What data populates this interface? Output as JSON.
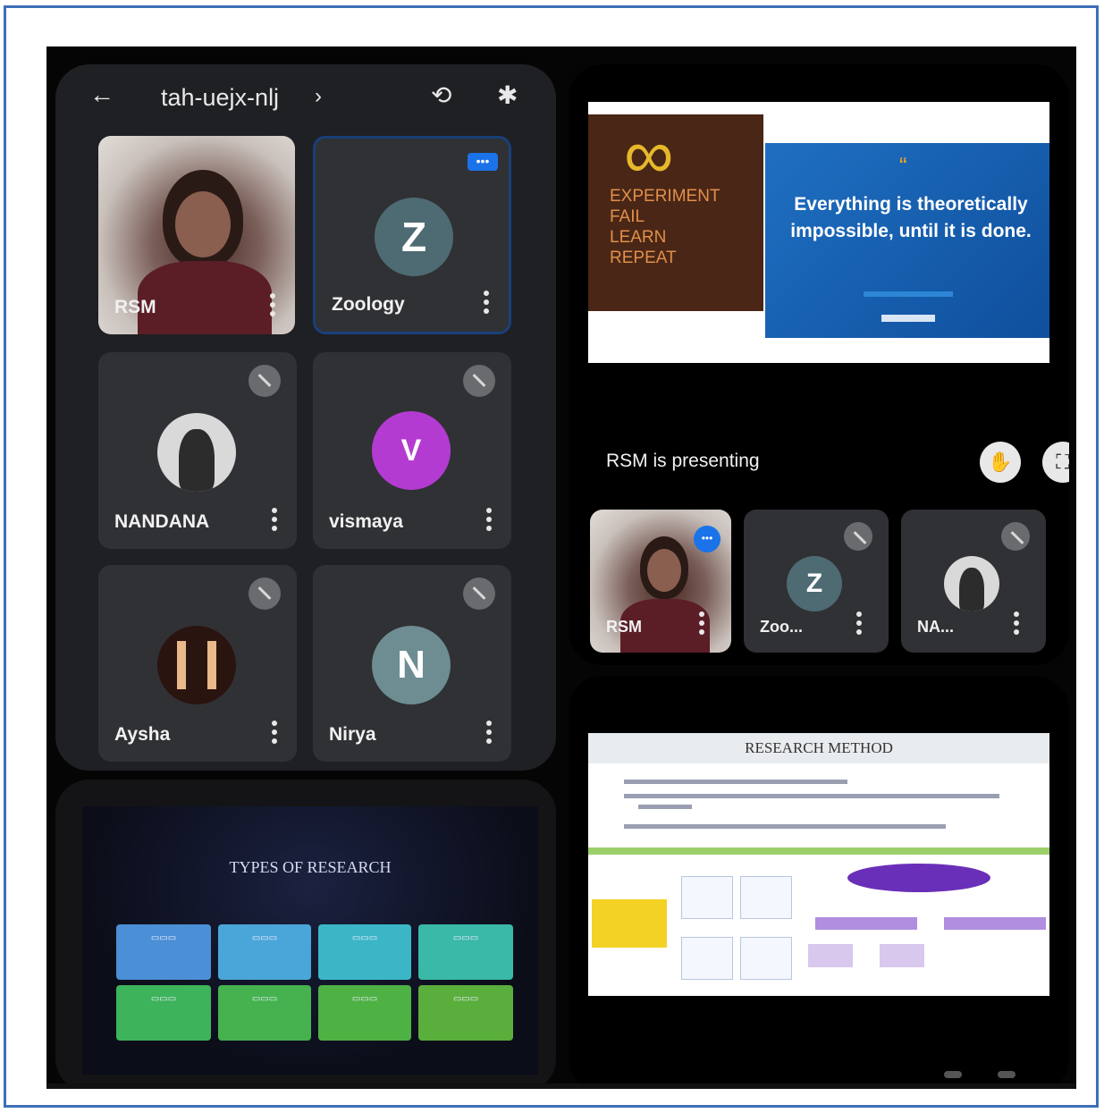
{
  "meeting": {
    "code": "tah-uejx-nlj",
    "code_caret": "›"
  },
  "participants": [
    {
      "name": "RSM",
      "initial": "",
      "color": ""
    },
    {
      "name": "Zoology",
      "initial": "Z",
      "color": "#4e6a72"
    },
    {
      "name": "NANDANA",
      "initial": "",
      "color": ""
    },
    {
      "name": "vismaya",
      "initial": "V",
      "color": "#b43bd1"
    },
    {
      "name": "Aysha",
      "initial": "",
      "color": ""
    },
    {
      "name": "Nirya",
      "initial": "N",
      "color": "#6d8d92"
    }
  ],
  "presentation": {
    "status_text": "RSM is presenting",
    "poster": {
      "left_lines": [
        "EXPERIMENT",
        "FAIL",
        "LEARN",
        "REPEAT"
      ],
      "quote": "Everything is theoretically impossible, until it is done."
    }
  },
  "filmstrip": [
    {
      "name": "RSM"
    },
    {
      "name": "Zoo...",
      "initial": "Z"
    },
    {
      "name": "NA..."
    }
  ],
  "slides": {
    "types_title": "TYPES OF RESEARCH",
    "method_title": "RESEARCH METHOD"
  },
  "colors": {
    "accent_blue": "#1a73e8",
    "frame_blue": "#3d6fb8",
    "tile_bg": "#303134"
  }
}
